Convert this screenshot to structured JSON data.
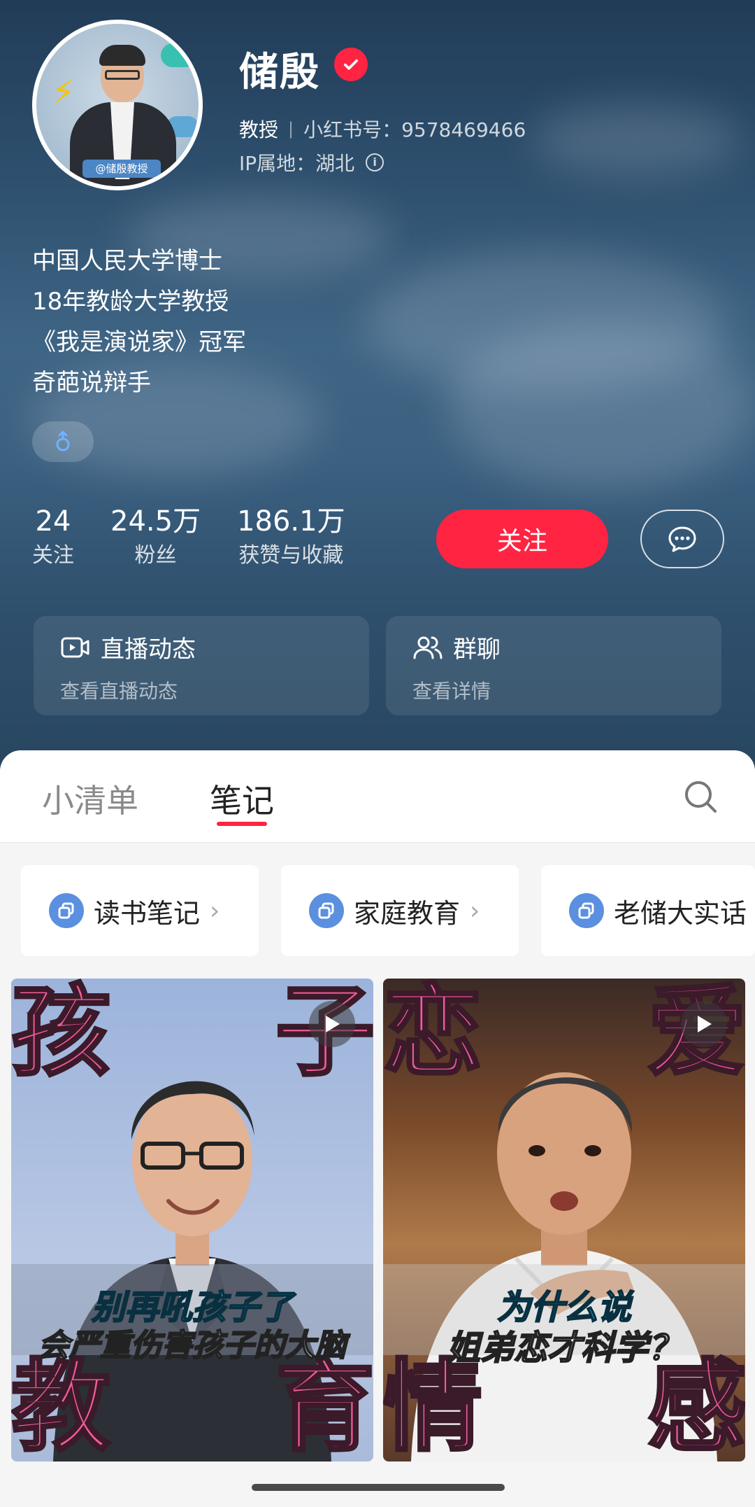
{
  "profile": {
    "name": "储殷",
    "title": "教授",
    "red_id": "小红书号：9578469466",
    "ip": "IP属地：湖北",
    "avatar_tag": "@储殷教授",
    "bio": [
      "中国人民大学博士",
      "18年教龄大学教授",
      "《我是演说家》冠军",
      "奇葩说辩手"
    ]
  },
  "stats": [
    {
      "value": "24",
      "label": "关注"
    },
    {
      "value": "24.5万",
      "label": "粉丝"
    },
    {
      "value": "186.1万",
      "label": "获赞与收藏"
    }
  ],
  "actions": {
    "follow": "关注"
  },
  "cards": [
    {
      "title": "直播动态",
      "sub": "查看直播动态",
      "icon": "live-video-icon"
    },
    {
      "title": "群聊",
      "sub": "查看详情",
      "icon": "group-chat-icon"
    }
  ],
  "tabs": {
    "lists": "小清单",
    "notes": "笔记",
    "active": "notes"
  },
  "albums": [
    {
      "label": "读书笔记"
    },
    {
      "label": "家庭教育"
    },
    {
      "label": "老储大实话"
    }
  ],
  "notes": [
    {
      "corners": [
        "孩",
        "子",
        "教",
        "育"
      ],
      "caption_line1": "别再吼孩子了",
      "caption_line2": "会严重伤害孩子的大脑"
    },
    {
      "corners": [
        "恋",
        "爱",
        "情",
        "感"
      ],
      "caption_line1": "为什么说",
      "caption_line2": "姐弟恋才科学？"
    }
  ],
  "colors": {
    "brand_red": "#ff2442",
    "header_bg": "#2c4d6b",
    "album_icon": "#5b8fe0"
  }
}
